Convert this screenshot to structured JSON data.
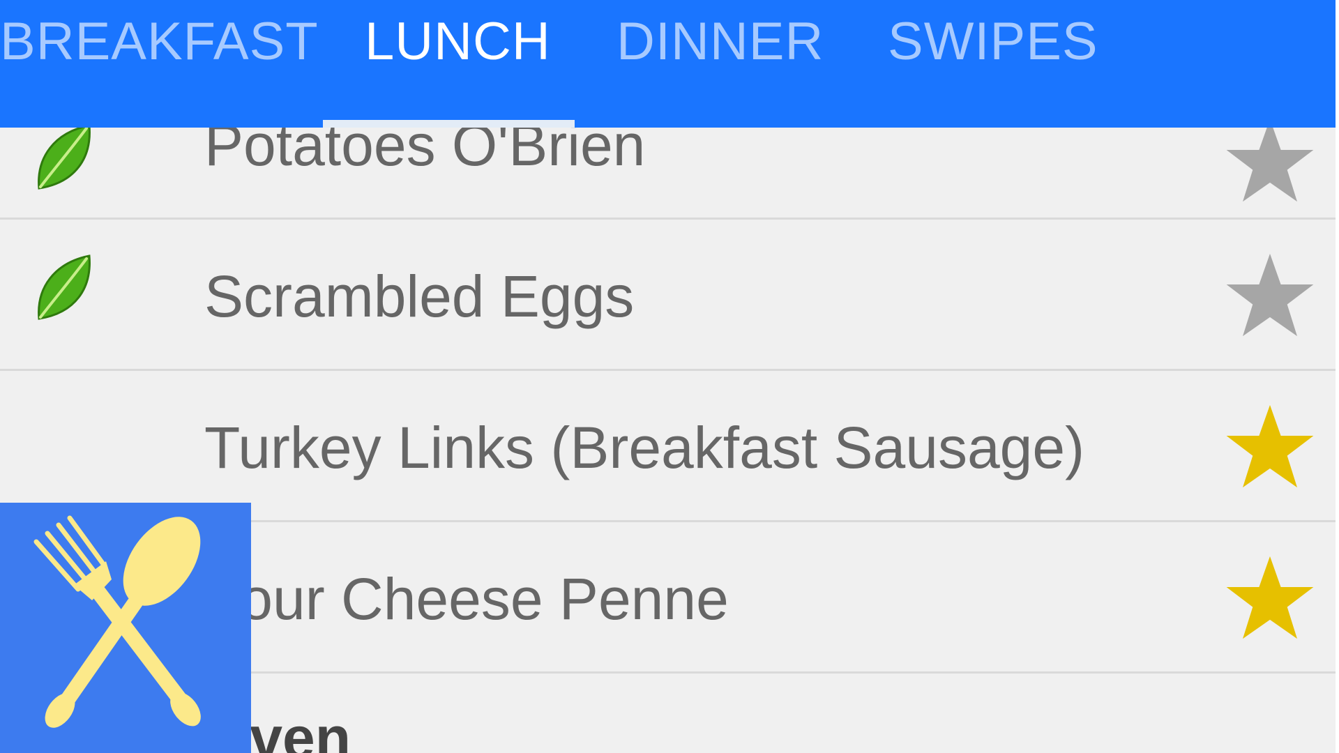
{
  "tabs": [
    {
      "label": "BREAKFAST",
      "active": false
    },
    {
      "label": "LUNCH",
      "active": true
    },
    {
      "label": "DINNER",
      "active": false
    },
    {
      "label": "SWIPES",
      "active": false
    }
  ],
  "menu_items": [
    {
      "name": "Potatoes O'Brien",
      "vegetarian": true,
      "favorite": false
    },
    {
      "name": "Scrambled Eggs",
      "vegetarian": true,
      "favorite": false
    },
    {
      "name": "Turkey Links (Breakfast Sausage)",
      "vegetarian": false,
      "favorite": true
    },
    {
      "name": "Four Cheese Penne",
      "vegetarian": false,
      "favorite": true
    }
  ],
  "section_header": "Oven",
  "icons": {
    "leaf": "leaf-icon",
    "star": "star-icon",
    "logo": "fork-spoon-icon"
  },
  "colors": {
    "tab_bar": "#1a75ff",
    "star_active": "#e6c000",
    "star_inactive": "#a6a6a6",
    "leaf": "#4caf1a",
    "logo_bg": "#3d7bef",
    "logo_fg": "#fce98a"
  }
}
